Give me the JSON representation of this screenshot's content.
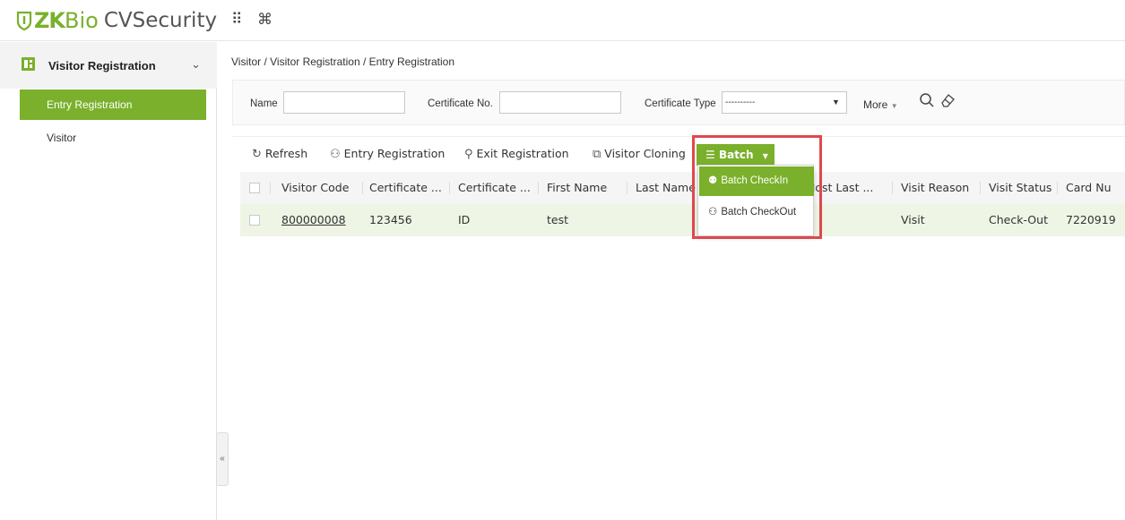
{
  "app": {
    "logo_zk": "ZK",
    "logo_bio": "Bio",
    "logo_product": "CVSecurity",
    "grid_icon": "grid-icon",
    "cmd_icon": "command-icon",
    "grid_glyph": "⠿",
    "cmd_glyph": "⌘"
  },
  "colors": {
    "accent": "#7ab02b",
    "highlight_border": "#e0474c"
  },
  "sidebar": {
    "module_title": "Visitor Registration",
    "items": [
      {
        "label": "Entry Registration",
        "active": true
      },
      {
        "label": "Visitor",
        "active": false
      }
    ],
    "collapse_glyph": "«"
  },
  "breadcrumb": "Visitor / Visitor Registration / Entry Registration",
  "search": {
    "name_label": "Name",
    "name_value": "",
    "certificate_no_label": "Certificate No.",
    "certificate_no_value": "",
    "certificate_type_label": "Certificate Type",
    "certificate_type_value": "----------",
    "more_label": "More"
  },
  "toolbar": {
    "refresh": "Refresh",
    "entry_registration": "Entry Registration",
    "exit_registration": "Exit Registration",
    "visitor_cloning": "Visitor Cloning",
    "batch": "Batch"
  },
  "table": {
    "columns": [
      "Visitor Code",
      "Certificate ...",
      "Certificate ...",
      "First Name",
      "Last Name",
      "Host Last ...",
      "Visit Reason",
      "Visit Status",
      "Card Nu"
    ],
    "rows": [
      {
        "visitor_code": "800000008",
        "certificate_no": "123456",
        "certificate_type": "ID",
        "first_name": "test",
        "last_name": "",
        "host_last": "",
        "visit_reason": "Visit",
        "visit_status": "Check-Out",
        "card_no": "7220919"
      }
    ]
  },
  "batch_menu": {
    "items": [
      "Batch CheckIn",
      "Batch CheckOut"
    ]
  }
}
